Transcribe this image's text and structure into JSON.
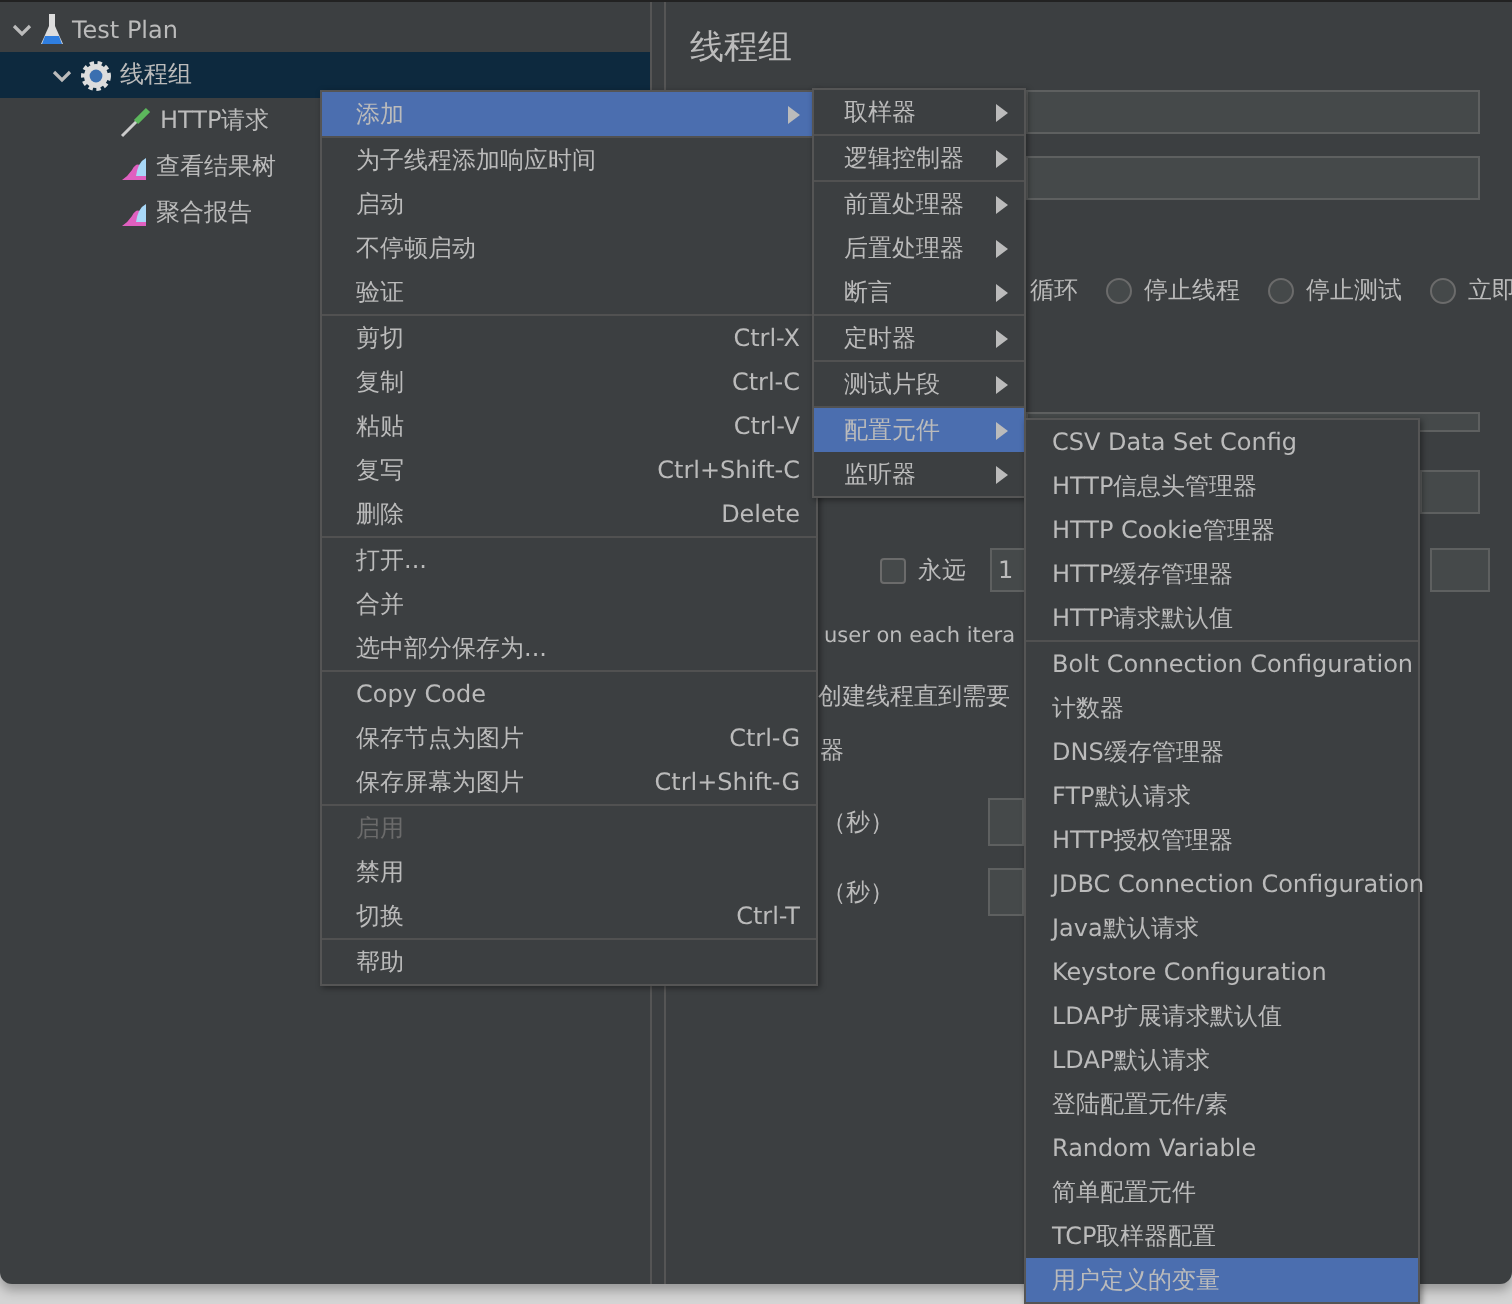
{
  "tree": [
    {
      "label": "Test Plan",
      "kind": "plan",
      "expanded": true,
      "selected": false,
      "children": [
        {
          "label": "线程组",
          "kind": "thread_group",
          "expanded": true,
          "selected": true,
          "children": [
            {
              "label": "HTTP请求",
              "kind": "sampler",
              "selected": false
            },
            {
              "label": "查看结果树",
              "kind": "listener",
              "selected": false
            },
            {
              "label": "聚合报告",
              "kind": "listener",
              "selected": false
            }
          ]
        }
      ]
    }
  ],
  "panel": {
    "title": "线程组",
    "loop_label": "循环",
    "radio_options": [
      {
        "label": "停止线程",
        "selected": false
      },
      {
        "label": "停止测试",
        "selected": false
      },
      {
        "label": "立即",
        "selected": false
      }
    ],
    "forever": {
      "label": "永远",
      "checked": false
    },
    "loop_count": "1",
    "texts": [
      "user on each itera",
      "创建线程直到需要",
      "器"
    ],
    "delay_labels": [
      "（秒）",
      "（秒）"
    ]
  },
  "context_menu": [
    [
      {
        "label": "添加",
        "has_submenu": true,
        "selected": true,
        "disabled": false
      }
    ],
    [
      {
        "label": "为子线程添加响应时间",
        "has_submenu": false,
        "selected": false,
        "disabled": false
      },
      {
        "label": "启动",
        "has_submenu": false,
        "selected": false,
        "disabled": false
      },
      {
        "label": "不停顿启动",
        "has_submenu": false,
        "selected": false,
        "disabled": false
      },
      {
        "label": "验证",
        "has_submenu": false,
        "selected": false,
        "disabled": false
      }
    ],
    [
      {
        "label": "剪切",
        "shortcut": "Ctrl-X",
        "has_submenu": false,
        "selected": false,
        "disabled": false
      },
      {
        "label": "复制",
        "shortcut": "Ctrl-C",
        "has_submenu": false,
        "selected": false,
        "disabled": false
      },
      {
        "label": "粘贴",
        "shortcut": "Ctrl-V",
        "has_submenu": false,
        "selected": false,
        "disabled": false
      },
      {
        "label": "复写",
        "shortcut": "Ctrl+Shift-C",
        "has_submenu": false,
        "selected": false,
        "disabled": false
      },
      {
        "label": "删除",
        "shortcut": "Delete",
        "has_submenu": false,
        "selected": false,
        "disabled": false
      }
    ],
    [
      {
        "label": "打开...",
        "has_submenu": false,
        "selected": false,
        "disabled": false
      },
      {
        "label": "合并",
        "has_submenu": false,
        "selected": false,
        "disabled": false
      },
      {
        "label": "选中部分保存为...",
        "has_submenu": false,
        "selected": false,
        "disabled": false
      }
    ],
    [
      {
        "label": "Copy Code",
        "has_submenu": false,
        "selected": false,
        "disabled": false
      },
      {
        "label": "保存节点为图片",
        "shortcut": "Ctrl-G",
        "has_submenu": false,
        "selected": false,
        "disabled": false
      },
      {
        "label": "保存屏幕为图片",
        "shortcut": "Ctrl+Shift-G",
        "has_submenu": false,
        "selected": false,
        "disabled": false
      }
    ],
    [
      {
        "label": "启用",
        "has_submenu": false,
        "selected": false,
        "disabled": true
      },
      {
        "label": "禁用",
        "has_submenu": false,
        "selected": false,
        "disabled": false
      },
      {
        "label": "切换",
        "shortcut": "Ctrl-T",
        "has_submenu": false,
        "selected": false,
        "disabled": false
      }
    ],
    [
      {
        "label": "帮助",
        "has_submenu": false,
        "selected": false,
        "disabled": false
      }
    ]
  ],
  "add_submenu": [
    [
      {
        "label": "取样器",
        "has_submenu": true,
        "selected": false,
        "disabled": false
      }
    ],
    [
      {
        "label": "逻辑控制器",
        "has_submenu": true,
        "selected": false,
        "disabled": false
      }
    ],
    [
      {
        "label": "前置处理器",
        "has_submenu": true,
        "selected": false,
        "disabled": false
      },
      {
        "label": "后置处理器",
        "has_submenu": true,
        "selected": false,
        "disabled": false
      },
      {
        "label": "断言",
        "has_submenu": true,
        "selected": false,
        "disabled": false
      }
    ],
    [
      {
        "label": "定时器",
        "has_submenu": true,
        "selected": false,
        "disabled": false
      }
    ],
    [
      {
        "label": "测试片段",
        "has_submenu": true,
        "selected": false,
        "disabled": false
      }
    ],
    [
      {
        "label": "配置元件",
        "has_submenu": true,
        "selected": true,
        "disabled": false
      },
      {
        "label": "监听器",
        "has_submenu": true,
        "selected": false,
        "disabled": false
      }
    ]
  ],
  "config_submenu": [
    [
      {
        "label": "CSV Data Set Config",
        "has_submenu": false,
        "selected": false,
        "disabled": false
      },
      {
        "label": "HTTP信息头管理器",
        "has_submenu": false,
        "selected": false,
        "disabled": false
      },
      {
        "label": "HTTP Cookie管理器",
        "has_submenu": false,
        "selected": false,
        "disabled": false
      },
      {
        "label": "HTTP缓存管理器",
        "has_submenu": false,
        "selected": false,
        "disabled": false
      },
      {
        "label": "HTTP请求默认值",
        "has_submenu": false,
        "selected": false,
        "disabled": false
      }
    ],
    [
      {
        "label": "Bolt Connection Configuration",
        "has_submenu": false,
        "selected": false,
        "disabled": false
      },
      {
        "label": "计数器",
        "has_submenu": false,
        "selected": false,
        "disabled": false
      },
      {
        "label": "DNS缓存管理器",
        "has_submenu": false,
        "selected": false,
        "disabled": false
      },
      {
        "label": "FTP默认请求",
        "has_submenu": false,
        "selected": false,
        "disabled": false
      },
      {
        "label": "HTTP授权管理器",
        "has_submenu": false,
        "selected": false,
        "disabled": false
      },
      {
        "label": "JDBC Connection Configuration",
        "has_submenu": false,
        "selected": false,
        "disabled": false
      },
      {
        "label": "Java默认请求",
        "has_submenu": false,
        "selected": false,
        "disabled": false
      },
      {
        "label": "Keystore Configuration",
        "has_submenu": false,
        "selected": false,
        "disabled": false
      },
      {
        "label": "LDAP扩展请求默认值",
        "has_submenu": false,
        "selected": false,
        "disabled": false
      },
      {
        "label": "LDAP默认请求",
        "has_submenu": false,
        "selected": false,
        "disabled": false
      },
      {
        "label": "登陆配置元件/素",
        "has_submenu": false,
        "selected": false,
        "disabled": false
      },
      {
        "label": "Random Variable",
        "has_submenu": false,
        "selected": false,
        "disabled": false
      },
      {
        "label": "简单配置元件",
        "has_submenu": false,
        "selected": false,
        "disabled": false
      },
      {
        "label": "TCP取样器配置",
        "has_submenu": false,
        "selected": false,
        "disabled": false
      },
      {
        "label": "用户定义的变量",
        "has_submenu": false,
        "selected": true,
        "disabled": false
      }
    ]
  ]
}
